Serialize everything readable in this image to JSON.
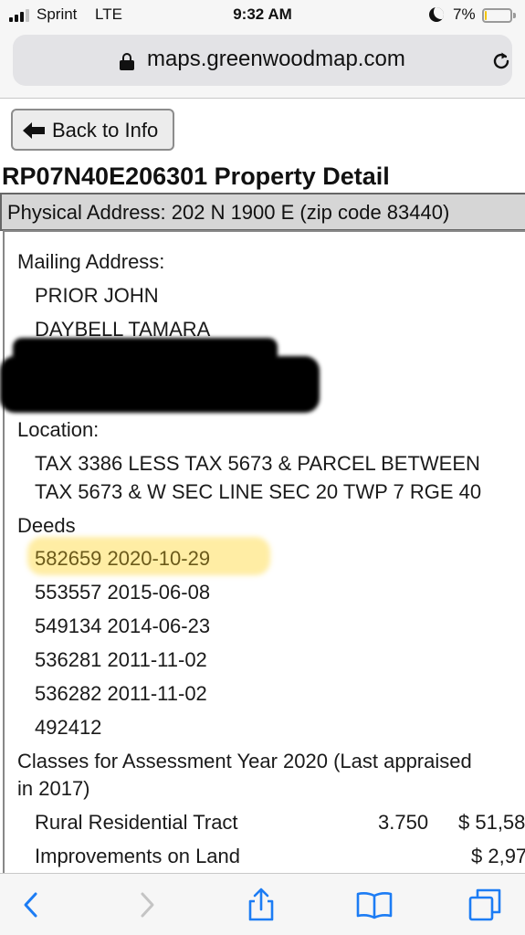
{
  "status_bar": {
    "carrier": "Sprint",
    "network": "LTE",
    "time": "9:32 AM",
    "battery": "7%",
    "battery_level": 0.07,
    "icons": [
      "signal-icon",
      "moon-icon",
      "battery-icon"
    ]
  },
  "browser": {
    "url": "maps.greenwoodmap.com",
    "icons": [
      "lock-icon",
      "reload-icon"
    ]
  },
  "page": {
    "back_label": "Back to Info",
    "title": "RP07N40E206301 Property Detail",
    "physical_address": "Physical Address: 202 N 1900 E (zip code 83440)",
    "mailing_label": "Mailing Address:",
    "mailing_names": [
      "PRIOR JOHN",
      "DAYBELL TAMARA"
    ],
    "location_label": "Location:",
    "location_lines": [
      "TAX 3386 LESS TAX 5673 & PARCEL BETWEEN",
      "TAX 5673 & W SEC LINE SEC 20 TWP 7 RGE 40"
    ],
    "deeds_label": "Deeds",
    "deeds": [
      "582659 2020-10-29",
      "553557 2015-06-08",
      "549134 2014-06-23",
      "536281 2011-11-02",
      "536282 2011-11-02",
      "492412"
    ],
    "classes_line1": "Classes for Assessment Year 2020 (Last appraised",
    "classes_line2": "in 2017)",
    "classes": [
      {
        "name": "Rural Residential Tract",
        "acres": "3.750",
        "value": "$ 51,58"
      },
      {
        "name": "Improvements on Land",
        "acres": "",
        "value": "$ 2,97"
      }
    ],
    "highlight_color": "#ffde5a"
  },
  "toolbar": {
    "icons": [
      "back-icon",
      "forward-icon",
      "share-icon",
      "bookmarks-icon",
      "tabs-icon"
    ]
  }
}
